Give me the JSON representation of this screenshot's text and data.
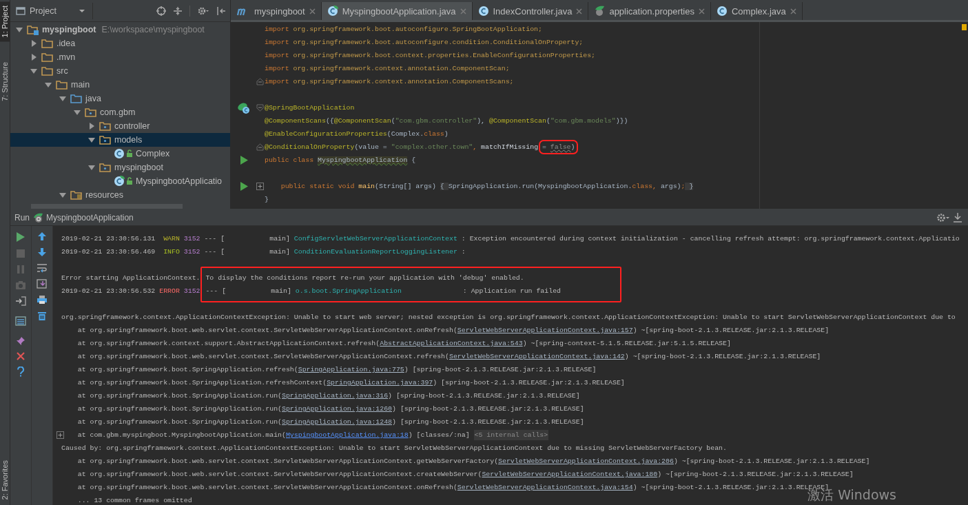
{
  "tool_strip": {
    "top": [
      {
        "label": "1: Project",
        "selected": true
      },
      {
        "label": "7: Structure",
        "selected": false
      }
    ],
    "bottom": [
      {
        "label": "2: Favorites",
        "selected": false
      }
    ]
  },
  "project": {
    "view": "Project",
    "tree": [
      {
        "label": "myspingboot",
        "path": "E:\\workspace\\myspingboot",
        "kind": "module",
        "expanded": true,
        "selected": false,
        "children": [
          {
            "label": ".idea",
            "kind": "folder",
            "expanded": false,
            "selected": false
          },
          {
            "label": ".mvn",
            "kind": "folder",
            "expanded": false,
            "selected": false
          },
          {
            "label": "src",
            "kind": "folder",
            "expanded": true,
            "selected": false,
            "children": [
              {
                "label": "main",
                "kind": "folder",
                "expanded": true,
                "selected": false,
                "children": [
                  {
                    "label": "java",
                    "kind": "source-folder",
                    "expanded": true,
                    "selected": false,
                    "children": [
                      {
                        "label": "com.gbm",
                        "kind": "package",
                        "expanded": true,
                        "selected": false,
                        "children": [
                          {
                            "label": "controller",
                            "kind": "package",
                            "expanded": false,
                            "selected": false
                          },
                          {
                            "label": "models",
                            "kind": "package",
                            "expanded": true,
                            "selected": true,
                            "children": [
                              {
                                "label": "Complex",
                                "kind": "class",
                                "selected": false
                              }
                            ]
                          },
                          {
                            "label": "myspingboot",
                            "kind": "package",
                            "expanded": true,
                            "selected": false,
                            "children": [
                              {
                                "label": "MyspingbootApplicatio",
                                "kind": "app-class",
                                "selected": false
                              }
                            ]
                          }
                        ]
                      }
                    ]
                  },
                  {
                    "label": "resources",
                    "kind": "resources-folder",
                    "expanded": true,
                    "selected": false
                  }
                ]
              }
            ]
          }
        ]
      }
    ]
  },
  "editor": {
    "tabs": [
      {
        "label": "myspingboot",
        "kind": "module",
        "selected": false
      },
      {
        "label": "MyspingbootApplication.java",
        "kind": "app-class",
        "selected": true
      },
      {
        "label": "IndexController.java",
        "kind": "class",
        "selected": false
      },
      {
        "label": "application.properties",
        "kind": "properties",
        "selected": false
      },
      {
        "label": "Complex.java",
        "kind": "class",
        "selected": false
      }
    ],
    "lines": [
      {
        "kind": "code",
        "segments": [
          {
            "text": "import",
            "kind": "kw"
          },
          {
            "text": " org.springframework.boot.autoconfigure.SpringBootApplication;",
            "kind": "imp"
          }
        ]
      },
      {
        "kind": "code",
        "segments": [
          {
            "text": "import",
            "kind": "kw"
          },
          {
            "text": " org.springframework.boot.autoconfigure.condition.ConditionalOnProperty;",
            "kind": "imp"
          }
        ]
      },
      {
        "kind": "code",
        "segments": [
          {
            "text": "import",
            "kind": "kw"
          },
          {
            "text": " org.springframework.boot.context.properties.EnableConfigurationProperties;",
            "kind": "imp"
          }
        ]
      },
      {
        "kind": "code",
        "segments": [
          {
            "text": "import",
            "kind": "kw"
          },
          {
            "text": " org.springframework.context.annotation.ComponentScan;",
            "kind": "imp"
          }
        ]
      },
      {
        "kind": "code",
        "fold_marker": {
          "kind": "end"
        },
        "segments": [
          {
            "text": "import",
            "kind": "kw"
          },
          {
            "text": " org.springframework.context.annotation.ComponentScans;",
            "kind": "imp"
          }
        ]
      },
      {
        "kind": "blank"
      },
      {
        "kind": "code",
        "gutter_icon": {
          "kind": "bean"
        },
        "fold_marker": {
          "kind": "start"
        },
        "segments": [
          {
            "text": "@SpringBootApplication",
            "kind": "ann"
          }
        ]
      },
      {
        "kind": "code",
        "segments": [
          {
            "text": "@ComponentScans",
            "kind": "ann"
          },
          {
            "text": "({",
            "kind": "txt"
          },
          {
            "text": "@ComponentScan",
            "kind": "ann"
          },
          {
            "text": "(",
            "kind": "txt"
          },
          {
            "text": "\"com.gbm.controller\"",
            "kind": "str"
          },
          {
            "text": "), ",
            "kind": "txt"
          },
          {
            "text": "@ComponentScan",
            "kind": "ann"
          },
          {
            "text": "(",
            "kind": "txt"
          },
          {
            "text": "\"com.gbm.models\"",
            "kind": "str"
          },
          {
            "text": ")})",
            "kind": "txt"
          }
        ]
      },
      {
        "kind": "code",
        "segments": [
          {
            "text": "@EnableConfigurationProperties",
            "kind": "ann"
          },
          {
            "text": "(Complex.",
            "kind": "txt"
          },
          {
            "text": "class",
            "kind": "kw"
          },
          {
            "text": ")",
            "kind": "txt"
          }
        ]
      },
      {
        "kind": "code",
        "fold_marker": {
          "kind": "end"
        },
        "segments": [
          {
            "text": "@ConditionalOnProperty",
            "kind": "ann"
          },
          {
            "text": "(value = ",
            "kind": "txt"
          },
          {
            "text": "\"complex.other.town\"",
            "kind": "str"
          },
          {
            "text": ", ",
            "kind": "kw"
          },
          {
            "text": "matchIfMissing ",
            "kind": "param"
          },
          {
            "kind": "boxed",
            "segments": [
              {
                "text": "= ",
                "kind": "txt"
              },
              {
                "text": "false",
                "kind": "dim"
              },
              {
                "text": ")",
                "kind": "txt"
              }
            ]
          }
        ]
      },
      {
        "kind": "code",
        "gutter_icon": {
          "kind": "run"
        },
        "segments": [
          {
            "text": "public class ",
            "kind": "kw"
          },
          {
            "text": "MyspingbootApplication",
            "kind": "cls-hl"
          },
          {
            "text": " {",
            "kind": "txt"
          }
        ]
      },
      {
        "kind": "blank"
      },
      {
        "kind": "code",
        "gutter_icon": {
          "kind": "run"
        },
        "fold_marker": {
          "kind": "plus"
        },
        "segments": [
          {
            "text": "    public static void ",
            "kind": "kw"
          },
          {
            "text": "main",
            "kind": "fn"
          },
          {
            "text": "(String[] args) ",
            "kind": "txt"
          },
          {
            "text": "{ ",
            "kind": "folded"
          },
          {
            "text": "SpringApplication.run(MyspingbootApplication.",
            "kind": "txt"
          },
          {
            "text": "class",
            "kind": "kw"
          },
          {
            "text": ", ",
            "kind": "kw"
          },
          {
            "text": "args)",
            "kind": "txt"
          },
          {
            "text": ";",
            "kind": "kw"
          },
          {
            "text": " }",
            "kind": "folded"
          }
        ]
      },
      {
        "kind": "code",
        "segments": [
          {
            "text": "}",
            "kind": "txt"
          }
        ]
      }
    ]
  },
  "run": {
    "label": "Run",
    "config": "MyspingbootApplication",
    "console": [
      {
        "kind": "line",
        "segments": [
          {
            "text": "2019-02-21 23:30:56.131 ",
            "kind": "text"
          },
          {
            "text": " WARN",
            "kind": "warn"
          },
          {
            "text": " 3152",
            "kind": "pid"
          },
          {
            "text": " --- [           main] ",
            "kind": "text"
          },
          {
            "text": "ConfigServletWebServerApplicationContext",
            "kind": "logger"
          },
          {
            "text": " : Exception encountered during context initialization - cancelling refresh attempt: org.springframework.context.Applicatio",
            "kind": "text"
          }
        ]
      },
      {
        "kind": "line",
        "segments": [
          {
            "text": "2019-02-21 23:30:56.469 ",
            "kind": "text"
          },
          {
            "text": " INFO",
            "kind": "info"
          },
          {
            "text": " 3152",
            "kind": "pid"
          },
          {
            "text": " --- [           main] ",
            "kind": "text"
          },
          {
            "text": "ConditionEvaluationReportLoggingListener",
            "kind": "logger"
          },
          {
            "text": " :",
            "kind": "text"
          }
        ]
      },
      {
        "kind": "blank"
      },
      {
        "kind": "boxed",
        "lines": [
          {
            "lead": [
              {
                "text": "Error starting ApplicationContext.",
                "kind": "text"
              }
            ],
            "boxed": [
              {
                "text": "To display the conditions report re-run your application with 'debug' enabled.",
                "kind": "text"
              }
            ]
          },
          {
            "lead": [
              {
                "text": "2019-02-21 23:30:56.532 ",
                "kind": "text"
              },
              {
                "text": "ERROR",
                "kind": "error"
              },
              {
                "text": " 3152",
                "kind": "pid"
              }
            ],
            "boxed": [
              {
                "text": "--- [           main] ",
                "kind": "text"
              },
              {
                "text": "o.s.boot.SpringApplication",
                "kind": "logger"
              },
              {
                "text": "               : Application run failed",
                "kind": "text"
              }
            ]
          }
        ]
      },
      {
        "kind": "blank"
      },
      {
        "kind": "line",
        "segments": [
          {
            "text": "org.springframework.context.ApplicationContextException: Unable to start web server; nested exception is org.springframework.context.ApplicationContextException: Unable to start ServletWebServerApplicationContext due to",
            "kind": "text"
          }
        ]
      },
      {
        "kind": "frame",
        "segments": [
          {
            "text": "at org.springframework.boot.web.servlet.context.ServletWebServerApplicationContext.onRefresh(",
            "kind": "text"
          },
          {
            "text": "ServletWebServerApplicationContext.java:157",
            "kind": "link"
          },
          {
            "text": ") ~[spring-boot-2.1.3.RELEASE.jar:2.1.3.RELEASE]",
            "kind": "text"
          }
        ]
      },
      {
        "kind": "frame",
        "segments": [
          {
            "text": "at org.springframework.context.support.AbstractApplicationContext.refresh(",
            "kind": "text"
          },
          {
            "text": "AbstractApplicationContext.java:543",
            "kind": "link"
          },
          {
            "text": ") ~[spring-context-5.1.5.RELEASE.jar:5.1.5.RELEASE]",
            "kind": "text"
          }
        ]
      },
      {
        "kind": "frame",
        "segments": [
          {
            "text": "at org.springframework.boot.web.servlet.context.ServletWebServerApplicationContext.refresh(",
            "kind": "text"
          },
          {
            "text": "ServletWebServerApplicationContext.java:142",
            "kind": "link"
          },
          {
            "text": ") ~[spring-boot-2.1.3.RELEASE.jar:2.1.3.RELEASE]",
            "kind": "text"
          }
        ]
      },
      {
        "kind": "frame",
        "segments": [
          {
            "text": "at org.springframework.boot.SpringApplication.refresh(",
            "kind": "text"
          },
          {
            "text": "SpringApplication.java:775",
            "kind": "link"
          },
          {
            "text": ") [spring-boot-2.1.3.RELEASE.jar:2.1.3.RELEASE]",
            "kind": "text"
          }
        ]
      },
      {
        "kind": "frame",
        "segments": [
          {
            "text": "at org.springframework.boot.SpringApplication.refreshContext(",
            "kind": "text"
          },
          {
            "text": "SpringApplication.java:397",
            "kind": "link"
          },
          {
            "text": ") [spring-boot-2.1.3.RELEASE.jar:2.1.3.RELEASE]",
            "kind": "text"
          }
        ]
      },
      {
        "kind": "frame",
        "segments": [
          {
            "text": "at org.springframework.boot.SpringApplication.run(",
            "kind": "text"
          },
          {
            "text": "SpringApplication.java:316",
            "kind": "link"
          },
          {
            "text": ") [spring-boot-2.1.3.RELEASE.jar:2.1.3.RELEASE]",
            "kind": "text"
          }
        ]
      },
      {
        "kind": "frame",
        "segments": [
          {
            "text": "at org.springframework.boot.SpringApplication.run(",
            "kind": "text"
          },
          {
            "text": "SpringApplication.java:1260",
            "kind": "link"
          },
          {
            "text": ") [spring-boot-2.1.3.RELEASE.jar:2.1.3.RELEASE]",
            "kind": "text"
          }
        ]
      },
      {
        "kind": "frame",
        "segments": [
          {
            "text": "at org.springframework.boot.SpringApplication.run(",
            "kind": "text"
          },
          {
            "text": "SpringApplication.java:1248",
            "kind": "link"
          },
          {
            "text": ") [spring-boot-2.1.3.RELEASE.jar:2.1.3.RELEASE]",
            "kind": "text"
          }
        ]
      },
      {
        "kind": "frame",
        "foldable": true,
        "segments": [
          {
            "text": "at com.gbm.myspingboot.MyspingbootApplication.main(",
            "kind": "text"
          },
          {
            "text": "MyspingbootApplication.java:18",
            "kind": "link-main"
          },
          {
            "text": ") [classes/:na] ",
            "kind": "text"
          },
          {
            "text": "<5 internal calls>",
            "kind": "fold"
          }
        ]
      },
      {
        "kind": "line",
        "segments": [
          {
            "text": "Caused by: org.springframework.context.ApplicationContextException: Unable to start ServletWebServerApplicationContext due to missing ServletWebServerFactory bean.",
            "kind": "text"
          }
        ]
      },
      {
        "kind": "frame",
        "segments": [
          {
            "text": "at org.springframework.boot.web.servlet.context.ServletWebServerApplicationContext.getWebServerFactory(",
            "kind": "text"
          },
          {
            "text": "ServletWebServerApplicationContext.java:206",
            "kind": "link"
          },
          {
            "text": ") ~[spring-boot-2.1.3.RELEASE.jar:2.1.3.RELEASE]",
            "kind": "text"
          }
        ]
      },
      {
        "kind": "frame",
        "segments": [
          {
            "text": "at org.springframework.boot.web.servlet.context.ServletWebServerApplicationContext.createWebServer(",
            "kind": "text"
          },
          {
            "text": "ServletWebServerApplicationContext.java:180",
            "kind": "link"
          },
          {
            "text": ") ~[spring-boot-2.1.3.RELEASE.jar:2.1.3.RELEASE]",
            "kind": "text"
          }
        ]
      },
      {
        "kind": "frame",
        "segments": [
          {
            "text": "at org.springframework.boot.web.servlet.context.ServletWebServerApplicationContext.onRefresh(",
            "kind": "text"
          },
          {
            "text": "ServletWebServerApplicationContext.java:154",
            "kind": "link"
          },
          {
            "text": ") ~[spring-boot-2.1.3.RELEASE.jar:2.1.3.RELEASE]",
            "kind": "text"
          }
        ]
      },
      {
        "kind": "frame",
        "segments": [
          {
            "text": "... 13 common frames omitted",
            "kind": "text"
          }
        ]
      }
    ]
  },
  "os_watermark": "激活 Windows"
}
